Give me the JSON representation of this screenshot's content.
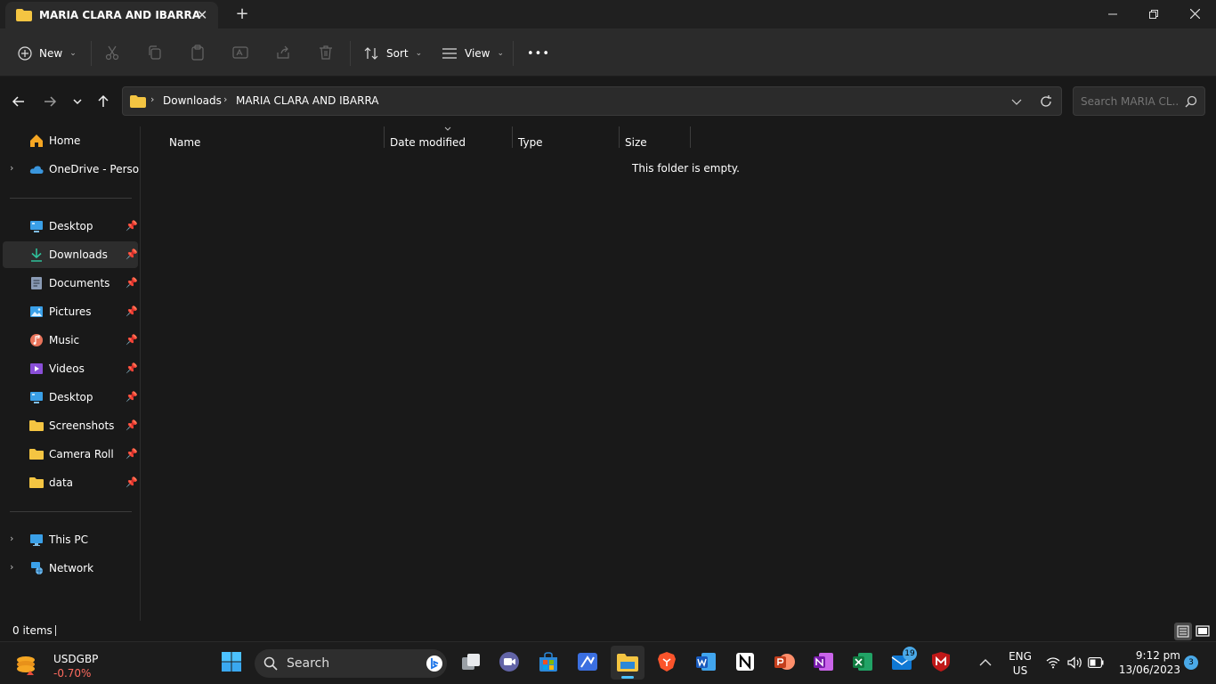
{
  "window": {
    "tab_title": "MARIA CLARA AND IBARRA",
    "close_tab": "✕",
    "new_tab": "+"
  },
  "toolbar": {
    "new_label": "New",
    "sort_label": "Sort",
    "view_label": "View",
    "more": "•••"
  },
  "address": {
    "crumbs": [
      "Downloads",
      "MARIA CLARA AND IBARRA"
    ],
    "separator": "›"
  },
  "search": {
    "placeholder": "Search MARIA CL..."
  },
  "sidebar": {
    "top": [
      {
        "label": "Home"
      },
      {
        "label": "OneDrive - Persona"
      }
    ],
    "pinned": [
      {
        "label": "Desktop"
      },
      {
        "label": "Downloads"
      },
      {
        "label": "Documents"
      },
      {
        "label": "Pictures"
      },
      {
        "label": "Music"
      },
      {
        "label": "Videos"
      },
      {
        "label": "Desktop"
      },
      {
        "label": "Screenshots"
      },
      {
        "label": "Camera Roll"
      },
      {
        "label": "data"
      }
    ],
    "bottom": [
      {
        "label": "This PC"
      },
      {
        "label": "Network"
      }
    ]
  },
  "columns": [
    "Name",
    "Date modified",
    "Type",
    "Size"
  ],
  "empty_message": "This folder is empty.",
  "status": {
    "items": "0 items"
  },
  "taskbar": {
    "stock_symbol": "USDGBP",
    "stock_change": "-0.70%",
    "search_label": "Search",
    "lang_top": "ENG",
    "lang_bottom": "US",
    "time": "9:12 pm",
    "date": "13/06/2023",
    "notification_count": "3",
    "mail_badge": "19"
  },
  "colors": {
    "folder_yellow": "#f4c542",
    "accent_blue": "#4aa9e8"
  }
}
